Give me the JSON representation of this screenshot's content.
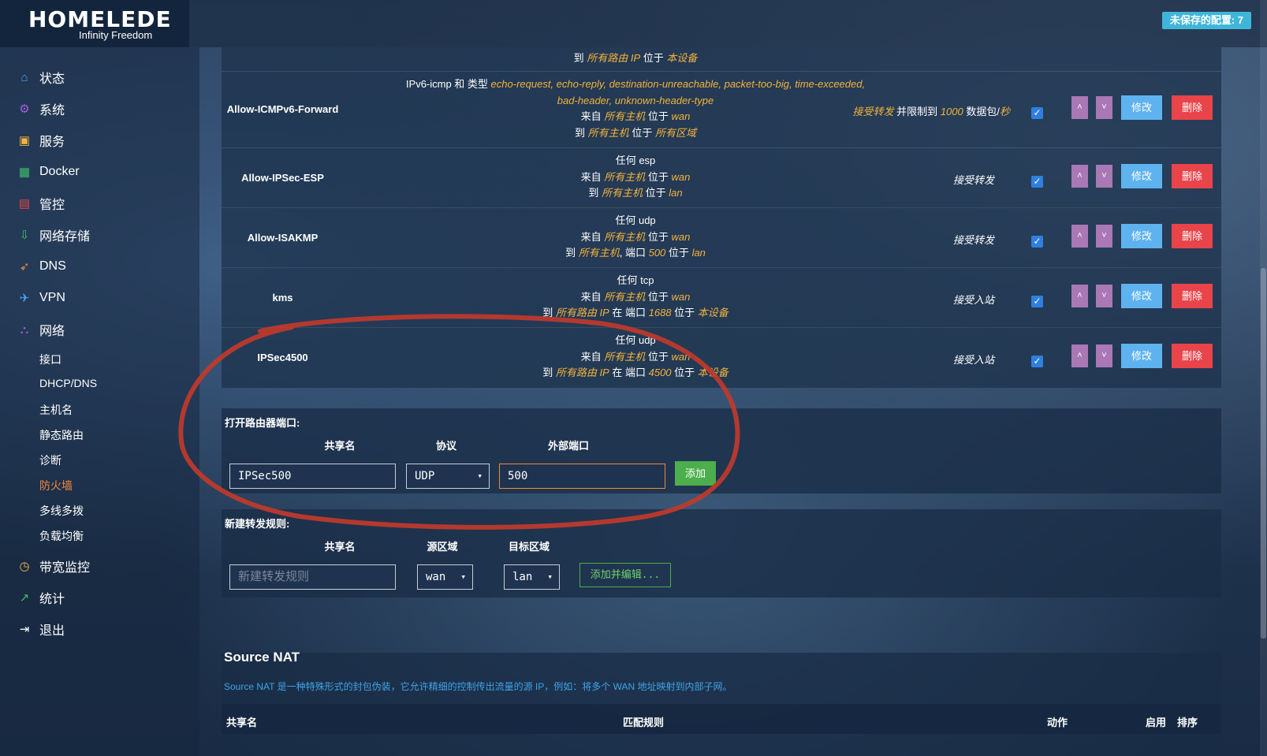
{
  "header": {
    "logo_main": "HOMELEDE",
    "logo_sub": "Infinity Freedom",
    "unsaved_badge": "未保存的配置: 7"
  },
  "sidebar": {
    "items": [
      {
        "label": "状态",
        "icon": "home-icon",
        "color": "#4aa3f0"
      },
      {
        "label": "系统",
        "icon": "gear-icon",
        "color": "#a35ee0"
      },
      {
        "label": "服务",
        "icon": "services-icon",
        "color": "#f2b43c"
      },
      {
        "label": "Docker",
        "icon": "grid-icon",
        "color": "#3cc36a"
      },
      {
        "label": "管控",
        "icon": "calendar-icon",
        "color": "#e8444a"
      },
      {
        "label": "网络存储",
        "icon": "download-icon",
        "color": "#3cc36a"
      },
      {
        "label": "DNS",
        "icon": "rocket-icon",
        "color": "#f0883e"
      },
      {
        "label": "VPN",
        "icon": "plane-icon",
        "color": "#4aa3f0"
      },
      {
        "label": "网络",
        "icon": "network-icon",
        "color": "#a35ee0"
      }
    ],
    "network_sub": [
      "接口",
      "DHCP/DNS",
      "主机名",
      "静态路由",
      "诊断",
      "防火墙",
      "多线多拨",
      "负载均衡"
    ],
    "bottom_items": [
      {
        "label": "带宽监控",
        "icon": "gauge-icon",
        "color": "#f2b43c"
      },
      {
        "label": "统计",
        "icon": "chart-icon",
        "color": "#3cc36a"
      },
      {
        "label": "退出",
        "icon": "logout-icon",
        "color": "#ffffff"
      }
    ]
  },
  "rules": {
    "top_partial": {
      "prefix": "到",
      "host": "所有路由 IP",
      "mid": "位于",
      "zone": "本设备"
    },
    "rows": [
      {
        "name": "Allow-ICMPv6-Forward",
        "line1_a": "IPv6-icmp 和 类型",
        "line1_b": "echo-request, echo-reply, destination-unreachable, packet-too-big, time-exceeded,",
        "line2": "bad-header, unknown-header-type",
        "from_a": "来自",
        "from_host": "所有主机",
        "from_mid": "位于",
        "from_zone": "wan",
        "to_a": "到",
        "to_host": "所有主机",
        "to_mid": "位于",
        "to_zone": "所有区域",
        "action_a": "接受转发",
        "action_b": "并限制到",
        "action_c": "1000",
        "action_d": "数据包/",
        "action_e": "秒"
      },
      {
        "name": "Allow-IPSec-ESP",
        "proto_a": "任何",
        "proto_b": "esp",
        "from_a": "来自",
        "from_host": "所有主机",
        "from_mid": "位于",
        "from_zone": "wan",
        "to_a": "到",
        "to_host": "所有主机",
        "to_mid": "位于",
        "to_zone": "lan",
        "action": "接受转发"
      },
      {
        "name": "Allow-ISAKMP",
        "proto_a": "任何",
        "proto_b": "udp",
        "from_a": "来自",
        "from_host": "所有主机",
        "from_mid": "位于",
        "from_zone": "wan",
        "to_a": "到",
        "to_host": "所有主机",
        "to_port_a": ", 端口",
        "to_port": "500",
        "to_mid": "位于",
        "to_zone": "lan",
        "action": "接受转发"
      },
      {
        "name": "kms",
        "proto_a": "任何",
        "proto_b": "tcp",
        "from_a": "来自",
        "from_host": "所有主机",
        "from_mid": "位于",
        "from_zone": "wan",
        "to_a": "到",
        "to_host": "所有路由 IP",
        "to_port_a": "在 端口",
        "to_port": "1688",
        "to_mid": "位于",
        "to_zone": "本设备",
        "action": "接受入站"
      },
      {
        "name": "IPSec4500",
        "proto_a": "任何",
        "proto_b": "udp",
        "from_a": "来自",
        "from_host": "所有主机",
        "from_mid": "位于",
        "from_zone": "wan",
        "to_a": "到",
        "to_host": "所有路由 IP",
        "to_port_a": "在 端口",
        "to_port": "4500",
        "to_mid": "位于",
        "to_zone": "本设备",
        "action": "接受入站"
      }
    ],
    "up_label": "˄",
    "down_label": "˅",
    "edit_label": "修改",
    "delete_label": "删除",
    "check": "✓"
  },
  "open_port": {
    "title": "打开路由器端口:",
    "col_name": "共享名",
    "col_proto": "协议",
    "col_port": "外部端口",
    "name_value": "IPSec500",
    "proto_value": "UDP",
    "port_value": "500",
    "add_label": "添加"
  },
  "new_forward": {
    "title": "新建转发规则:",
    "col_name": "共享名",
    "col_src": "源区域",
    "col_dst": "目标区域",
    "name_placeholder": "新建转发规则",
    "src_value": "wan",
    "dst_value": "lan",
    "add_edit_label": "添加并编辑..."
  },
  "source_nat": {
    "title": "Source NAT",
    "desc": "Source NAT 是一种特殊形式的封包伪装，它允许精细的控制传出流量的源 IP，例如：将多个 WAN 地址映射到内部子网。",
    "col_name": "共享名",
    "col_match": "匹配规则",
    "col_action": "动作",
    "col_enable": "启用",
    "col_sort": "排序"
  },
  "colors": {
    "accent_orange": "#f3b23c",
    "edit_blue": "#5eb3ef",
    "delete_red": "#e8444a",
    "sort_purple": "#a978b5",
    "add_green": "#4cae4c",
    "annotation_red": "#c0392b"
  }
}
